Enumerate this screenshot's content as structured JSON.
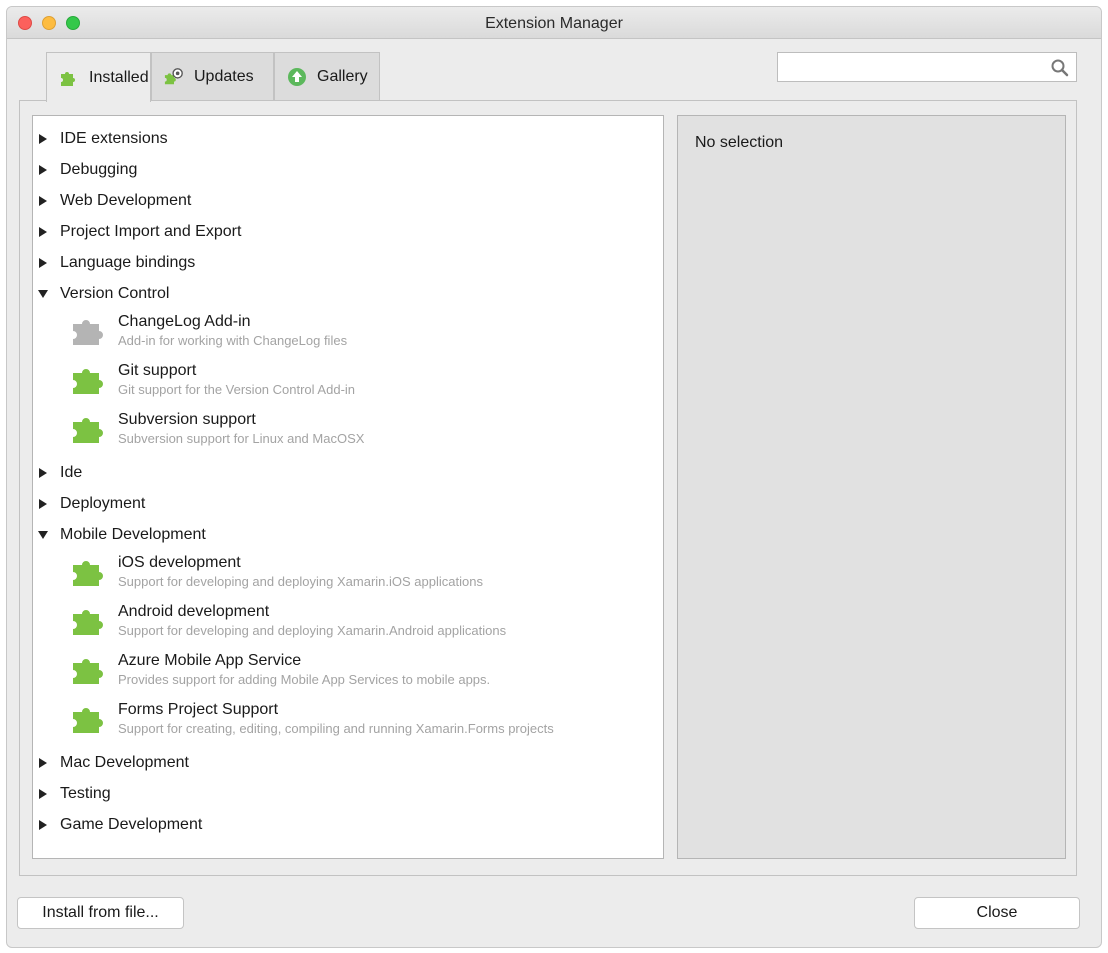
{
  "window": {
    "title": "Extension Manager"
  },
  "tabs": [
    {
      "label": "Installed",
      "icon": "puzzle-icon",
      "active": true
    },
    {
      "label": "Updates",
      "icon": "puzzle-update-icon",
      "active": false
    },
    {
      "label": "Gallery",
      "icon": "gallery-up-arrow-icon",
      "active": false
    }
  ],
  "search": {
    "value": "",
    "placeholder": "",
    "icon": "search-icon"
  },
  "tree": {
    "categories": [
      {
        "label": "IDE extensions",
        "expanded": false
      },
      {
        "label": "Debugging",
        "expanded": false
      },
      {
        "label": "Web Development",
        "expanded": false
      },
      {
        "label": "Project Import and Export",
        "expanded": false
      },
      {
        "label": "Language bindings",
        "expanded": false
      },
      {
        "label": "Version Control",
        "expanded": true
      },
      {
        "label": "Ide",
        "expanded": false
      },
      {
        "label": "Deployment",
        "expanded": false
      },
      {
        "label": "Mobile Development",
        "expanded": true
      },
      {
        "label": "Mac Development",
        "expanded": false
      },
      {
        "label": "Testing",
        "expanded": false
      },
      {
        "label": "Game Development",
        "expanded": false
      }
    ],
    "version_control_items": [
      {
        "name": "ChangeLog Add-in",
        "description": "Add-in for working with ChangeLog files",
        "enabled": false
      },
      {
        "name": "Git support",
        "description": "Git support for the Version Control Add-in",
        "enabled": true
      },
      {
        "name": "Subversion support",
        "description": "Subversion support for Linux and MacOSX",
        "enabled": true
      }
    ],
    "mobile_items": [
      {
        "name": "iOS development",
        "description": "Support for developing and deploying Xamarin.iOS applications",
        "enabled": true
      },
      {
        "name": "Android development",
        "description": "Support for developing and deploying Xamarin.Android applications",
        "enabled": true
      },
      {
        "name": "Azure Mobile App Service",
        "description": "Provides support for adding Mobile App Services to mobile apps.",
        "enabled": true
      },
      {
        "name": "Forms Project Support",
        "description": "Support for creating, editing, compiling and running Xamarin.Forms projects",
        "enabled": true
      }
    ]
  },
  "details": {
    "text": "No selection"
  },
  "buttons": {
    "install_from_file": "Install from file...",
    "close": "Close"
  },
  "colors": {
    "enabled_puzzle": "#7cc242",
    "disabled_puzzle": "#b4b4b4",
    "gallery_icon": "#5cb85c"
  }
}
